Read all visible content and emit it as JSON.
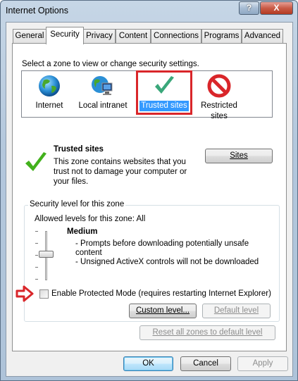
{
  "window": {
    "title": "Internet Options",
    "help_label": "?",
    "close_label": "X"
  },
  "tabs": [
    {
      "label": "General"
    },
    {
      "label": "Security"
    },
    {
      "label": "Privacy"
    },
    {
      "label": "Content"
    },
    {
      "label": "Connections"
    },
    {
      "label": "Programs"
    },
    {
      "label": "Advanced"
    }
  ],
  "security": {
    "zone_prompt": "Select a zone to view or change security settings.",
    "zones": [
      {
        "label": "Internet",
        "icon": "globe-icon"
      },
      {
        "label": "Local intranet",
        "icon": "intranet-icon"
      },
      {
        "label": "Trusted sites",
        "icon": "checkmark-icon"
      },
      {
        "label_line1": "Restricted",
        "label_line2": "sites",
        "icon": "restricted-icon"
      }
    ],
    "selected_zone": "Trusted sites",
    "detail": {
      "title": "Trusted sites",
      "description": "This zone contains websites that you trust not to damage your computer or your files.",
      "sites_button": "Sites"
    },
    "level_group": {
      "label": "Security level for this zone",
      "allowed": "Allowed levels for this zone: All",
      "level_name": "Medium",
      "bullet1": "- Prompts before downloading potentially unsafe content",
      "bullet2": "- Unsigned ActiveX controls will not be downloaded",
      "protected_mode_label": "Enable Protected Mode (requires restarting Internet Explorer)",
      "protected_mode_checked": false,
      "custom_level_button": "Custom level...",
      "default_level_button": "Default level"
    },
    "reset_button": "Reset all zones to default level"
  },
  "footer": {
    "ok": "OK",
    "cancel": "Cancel",
    "apply": "Apply"
  },
  "colors": {
    "selection": "#3399ff",
    "annotation_red": "#d9262a"
  }
}
